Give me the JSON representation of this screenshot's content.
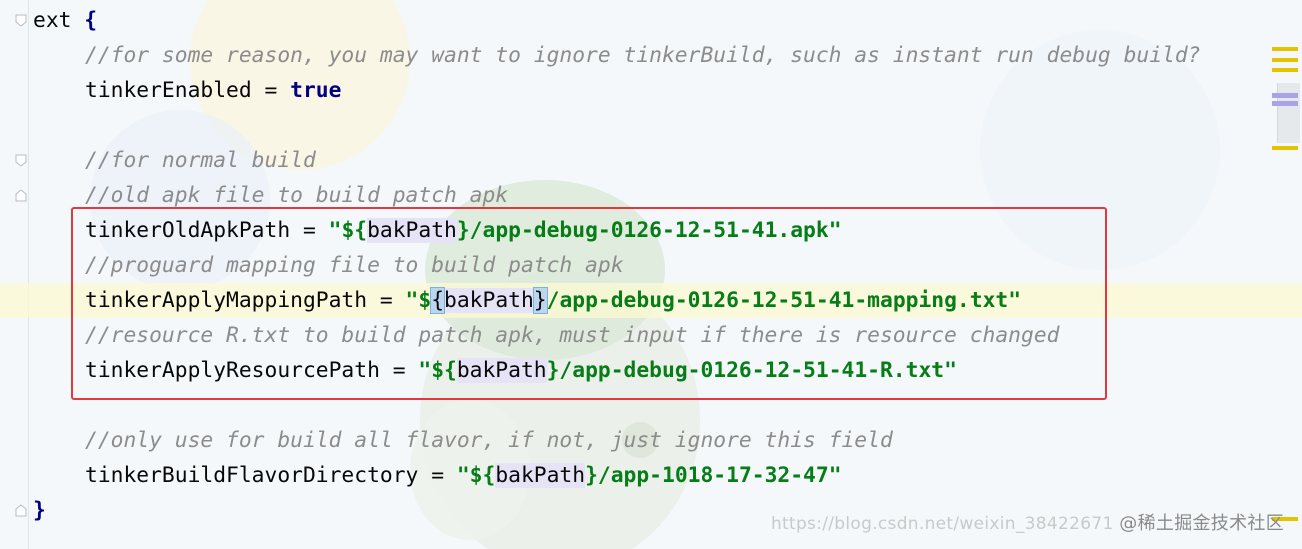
{
  "editor": {
    "lines": [
      {
        "type": "code",
        "indent": 0,
        "tokens": [
          {
            "t": "ext ",
            "c": "op"
          },
          {
            "t": "{",
            "c": "kw"
          }
        ]
      },
      {
        "type": "code",
        "indent": 1,
        "tokens": [
          {
            "t": "//for some reason, you may want to ignore tinkerBuild, such as instant run debug build?",
            "c": "cm"
          }
        ]
      },
      {
        "type": "code",
        "indent": 1,
        "tokens": [
          {
            "t": "tinkerEnabled = ",
            "c": "op"
          },
          {
            "t": "true",
            "c": "kw"
          }
        ]
      },
      {
        "type": "blank"
      },
      {
        "type": "code",
        "indent": 1,
        "tokens": [
          {
            "t": "//for normal build",
            "c": "cm"
          }
        ]
      },
      {
        "type": "code",
        "indent": 1,
        "tokens": [
          {
            "t": "//old apk file to build patch apk",
            "c": "cm"
          }
        ]
      },
      {
        "type": "code",
        "indent": 1,
        "tokens": [
          {
            "t": "tinkerOldApkPath = ",
            "c": "op"
          },
          {
            "t": "\"${",
            "c": "str"
          },
          {
            "t": "bakPath",
            "c": "tpl"
          },
          {
            "t": "}/app-debug-0126-12-51-41.apk\"",
            "c": "str"
          }
        ]
      },
      {
        "type": "code",
        "indent": 1,
        "tokens": [
          {
            "t": "//proguard mapping file to build patch apk",
            "c": "cm"
          }
        ]
      },
      {
        "type": "code",
        "indent": 1,
        "current": true,
        "tokens": [
          {
            "t": "tinkerApplyMappingPath = ",
            "c": "op"
          },
          {
            "t": "\"$",
            "c": "str"
          },
          {
            "t": "{",
            "c": "tpl-hi"
          },
          {
            "t": "bakPath",
            "c": "tpl"
          },
          {
            "t": "}",
            "c": "tpl-hi"
          },
          {
            "t": "/app-debug-0126-12-51-41-mapping.txt\"",
            "c": "str"
          }
        ]
      },
      {
        "type": "code",
        "indent": 1,
        "tokens": [
          {
            "t": "//resource R.txt to build patch apk, must input if there is resource changed",
            "c": "cm"
          }
        ]
      },
      {
        "type": "code",
        "indent": 1,
        "tokens": [
          {
            "t": "tinkerApplyResourcePath = ",
            "c": "op"
          },
          {
            "t": "\"${",
            "c": "str"
          },
          {
            "t": "bakPath",
            "c": "tpl"
          },
          {
            "t": "}/app-debug-0126-12-51-41-R.txt\"",
            "c": "str"
          }
        ]
      },
      {
        "type": "blank"
      },
      {
        "type": "code",
        "indent": 1,
        "tokens": [
          {
            "t": "//only use for build all flavor, if not, just ignore this field",
            "c": "cm"
          }
        ]
      },
      {
        "type": "code",
        "indent": 1,
        "tokens": [
          {
            "t": "tinkerBuildFlavorDirectory = ",
            "c": "op"
          },
          {
            "t": "\"${",
            "c": "str"
          },
          {
            "t": "bakPath",
            "c": "tpl"
          },
          {
            "t": "}/app-1018-17-32-47\"",
            "c": "str"
          }
        ]
      },
      {
        "type": "code",
        "indent": 0,
        "tokens": [
          {
            "t": "}",
            "c": "kw"
          }
        ]
      }
    ]
  },
  "colors": {
    "comment": "#8c8c8c",
    "keyword": "#000080",
    "string": "#067d17",
    "highlight_box": "#e0393e",
    "marker_yellow": "#e6c300",
    "marker_purple": "#a9a3e8"
  },
  "watermark": {
    "url_text": "https://blog.csdn.net/weixin_38422671",
    "brand_text": "@稀土掘金技术社区"
  }
}
